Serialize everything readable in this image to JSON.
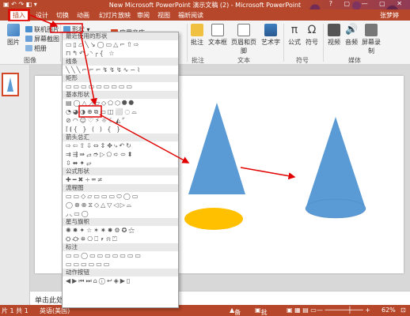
{
  "window": {
    "title": "New Microsoft PowerPoint 演示文稿 (2) - Microsoft PowerPoint",
    "user": "张梦婷"
  },
  "tabs": [
    "插入",
    "设计",
    "切换",
    "动画",
    "幻灯片放映",
    "审阅",
    "视图",
    "福昕阅读"
  ],
  "ribbon": {
    "groups": {
      "images": "图像",
      "text": "文本",
      "symbols": "符号",
      "media": "媒体"
    },
    "buttons": {
      "picture": "图片",
      "online_picture": "联机图片",
      "screenshot": "屏幕截图",
      "album": "相册",
      "shapes": "形状",
      "app_store": "应用商店",
      "comment": "批注",
      "textbox": "文本框",
      "header_footer": "页眉和页脚",
      "wordart": "艺术字",
      "formula": "公式",
      "symbol": "符号",
      "video": "视频",
      "audio": "音频",
      "screen_record": "屏幕录制"
    }
  },
  "shapes_menu": {
    "categories": [
      {
        "label": "最近使用的形状",
        "rows": [
          "▭▯▱╲↘◯▭△⌐⇧⇨",
          "⊓↰↶◞◝╭{ ☆"
        ]
      },
      {
        "label": "线条",
        "rows": [
          "╲╲╲⌐⌐⌐↯↯↯∿∽⌇"
        ]
      },
      {
        "label": "矩形",
        "rows": [
          "▭▭▭▭▭▭▭▭▭"
        ]
      },
      {
        "label": "基本形状",
        "rows": [
          "▤◯△◿▱◇⬠⬡⯃⯄",
          "◔◕◑⊕⧉▭◫⬜◌⌓",
          "⊘◠☺♡⚡☼☾◭⌜",
          "⌈⦗{ } ( ) { }"
        ]
      },
      {
        "label": "箭头总汇",
        "rows": [
          "⇨⇦⇧⇩⇔⇕✥⤷↶↻",
          "⇉⇶⇛⥄➮▷⬠➪⬄⬍",
          "⇳⬌✦⥂"
        ]
      },
      {
        "label": "公式形状",
        "rows": [
          "✚━✖÷═≠"
        ]
      },
      {
        "label": "流程图",
        "rows": [
          "▭▭◇▱▭▭▭⬭◯▭",
          "◯⊗⊕⧖◇△▽◁▷⌓",
          "◞◟▭◯"
        ]
      },
      {
        "label": "星与旗帜",
        "rows": [
          "✺✹✦☆✶✷✸⚙✪⚝",
          "⛭⛮⛯⎔⎕⎖⍾⏍"
        ]
      },
      {
        "label": "标注",
        "rows": [
          "▭▭◯▭▭▭▭▭▭▭",
          "▭▭▭▭▭▭"
        ]
      },
      {
        "label": "动作按钮",
        "rows": [
          "◀▶⏮⏭⌂ⓘ↩◈▶▯"
        ]
      }
    ]
  },
  "notes_placeholder": "单击此处添加备注",
  "status": {
    "slide": "片 1 共 1",
    "lang": "英语(美国)",
    "notes_btn": "备注",
    "comments_btn": "批注",
    "zoom": "62%"
  },
  "colors": {
    "accent": "#b7472a",
    "cone": "#5b9bd5",
    "ellipse": "#ffc000",
    "highlight": "#e00000"
  }
}
